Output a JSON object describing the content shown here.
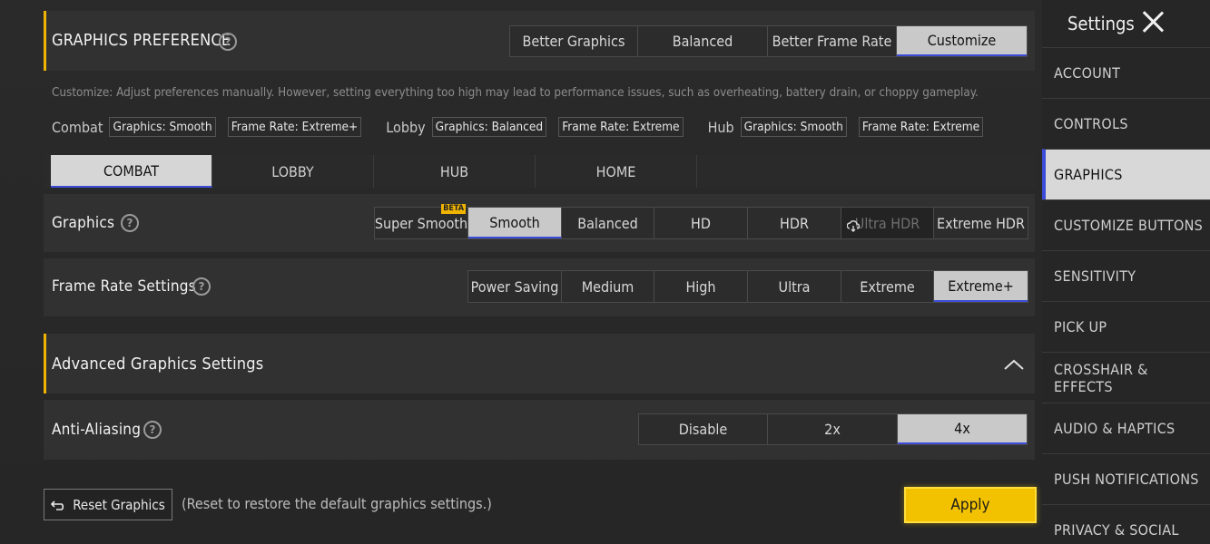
{
  "graphics_preference": {
    "title": "GRAPHICS PREFERENCE",
    "options": [
      "Better Graphics",
      "Balanced",
      "Better Frame Rate",
      "Customize"
    ],
    "selected": "Customize",
    "description": "Customize: Adjust preferences manually. However, setting everything too high may lead to performance issues, such as overheating, battery drain, or choppy gameplay."
  },
  "summary": {
    "combat_label": "Combat",
    "combat_graphics": "Graphics: Smooth",
    "combat_framerate": "Frame Rate: Extreme+",
    "lobby_label": "Lobby",
    "lobby_graphics": "Graphics: Balanced",
    "lobby_framerate": "Frame Rate: Extreme",
    "hub_label": "Hub",
    "hub_graphics": "Graphics: Smooth",
    "hub_framerate": "Frame Rate: Extreme"
  },
  "mode_tabs": [
    "COMBAT",
    "LOBBY",
    "HUB",
    "HOME"
  ],
  "mode_selected": "COMBAT",
  "graphics": {
    "label": "Graphics",
    "options": [
      "Super Smooth",
      "Smooth",
      "Balanced",
      "HD",
      "HDR",
      "Ultra HDR",
      "Extreme HDR"
    ],
    "selected": "Smooth",
    "beta_badge": "BETA"
  },
  "frame_rate": {
    "label": "Frame Rate Settings",
    "options": [
      "Power Saving",
      "Medium",
      "High",
      "Ultra",
      "Extreme",
      "Extreme+"
    ],
    "selected": "Extreme+"
  },
  "advanced": {
    "title": "Advanced Graphics Settings"
  },
  "anti_aliasing": {
    "label": "Anti-Aliasing",
    "options": [
      "Disable",
      "2x",
      "4x"
    ],
    "selected": "4x"
  },
  "footer": {
    "reset_label": "Reset Graphics",
    "reset_note": "(Reset to restore the default graphics settings.)",
    "apply_label": "Apply"
  },
  "sidebar": {
    "title": "Settings",
    "items": [
      "ACCOUNT",
      "CONTROLS",
      "GRAPHICS",
      "CUSTOMIZE BUTTONS",
      "SENSITIVITY",
      "PICK UP",
      "CROSSHAIR & EFFECTS",
      "AUDIO & HAPTICS",
      "PUSH NOTIFICATIONS",
      "PRIVACY & SOCIAL"
    ],
    "active": "GRAPHICS"
  },
  "help_glyph": "?",
  "colors": {
    "accent": "#f0b400",
    "selected_underline": "#3c4cd8",
    "apply_bg": "#f2c200"
  }
}
